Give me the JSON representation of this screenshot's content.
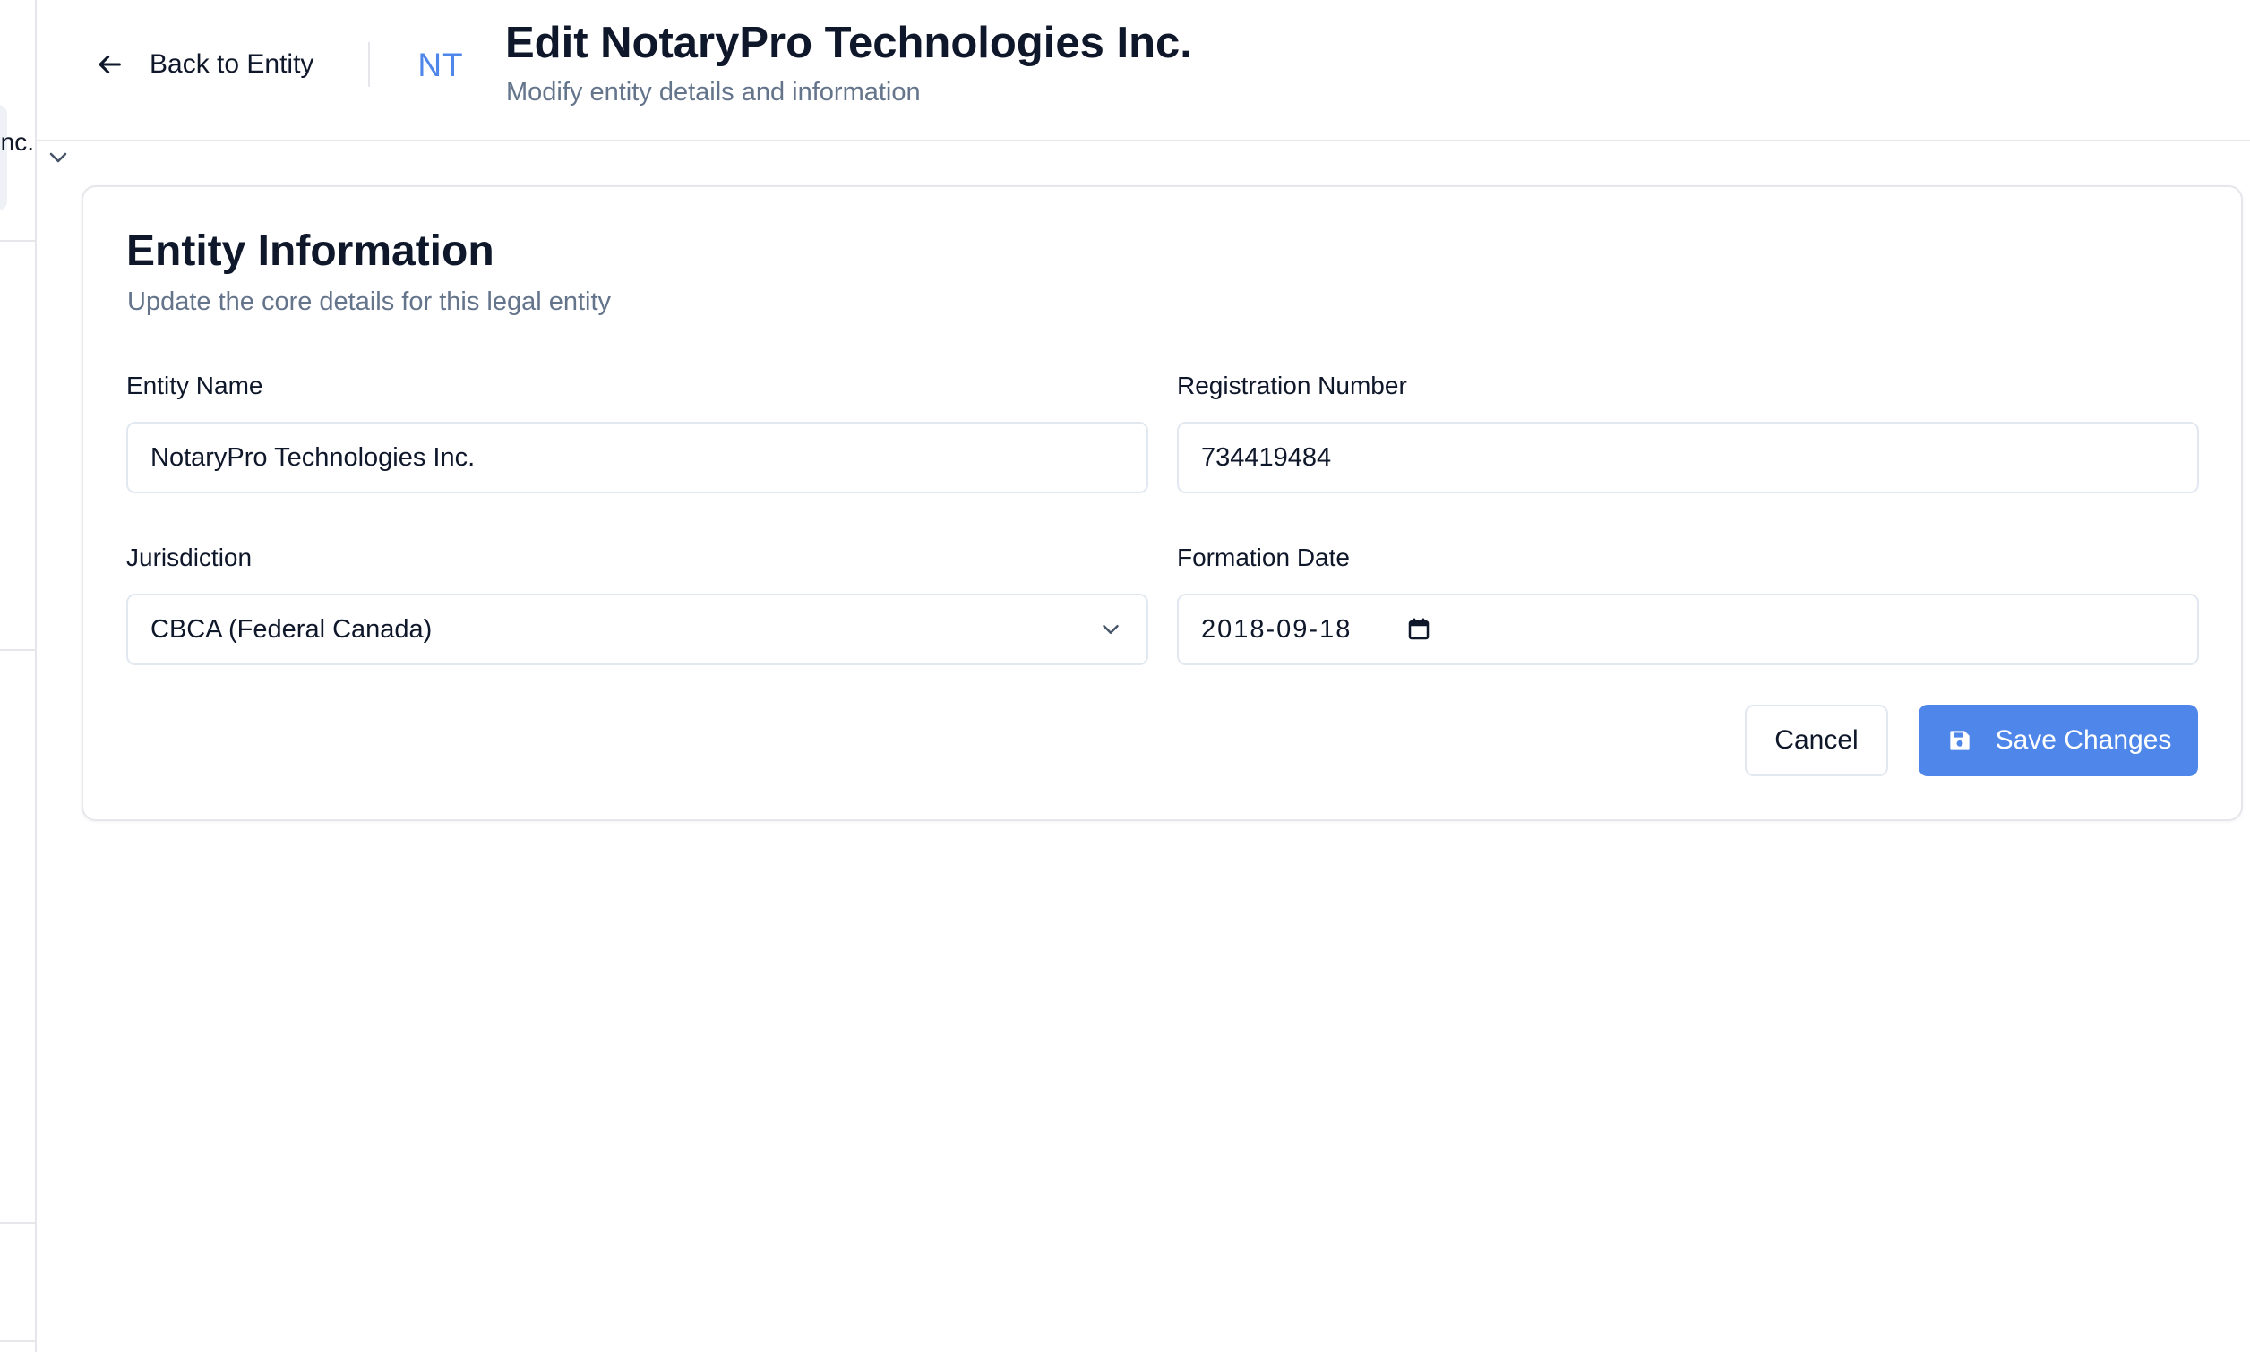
{
  "sidebar": {
    "entity_label_fragment": "Inc."
  },
  "header": {
    "back_label": "Back to Entity",
    "avatar_initials": "NT",
    "title": "Edit NotaryPro Technologies Inc.",
    "subtitle": "Modify entity details and information"
  },
  "card": {
    "title": "Entity Information",
    "subtitle": "Update the core details for this legal entity",
    "fields": {
      "entity_name": {
        "label": "Entity Name",
        "value": "NotaryPro Technologies Inc."
      },
      "registration_number": {
        "label": "Registration Number",
        "value": "734419484"
      },
      "jurisdiction": {
        "label": "Jurisdiction",
        "value": "CBCA (Federal Canada)"
      },
      "formation_date": {
        "label": "Formation Date",
        "value": "2018-09-18"
      }
    },
    "actions": {
      "cancel_label": "Cancel",
      "save_label": "Save Changes"
    }
  },
  "colors": {
    "accent": "#4f86ea",
    "text_primary": "#0f172a",
    "text_muted": "#64748b",
    "border": "#e2e8f0"
  },
  "icons": {
    "back": "arrow-left-icon",
    "collapse": "chevron-down-icon",
    "select": "chevron-down-icon",
    "date": "calendar-icon",
    "save": "save-icon"
  }
}
